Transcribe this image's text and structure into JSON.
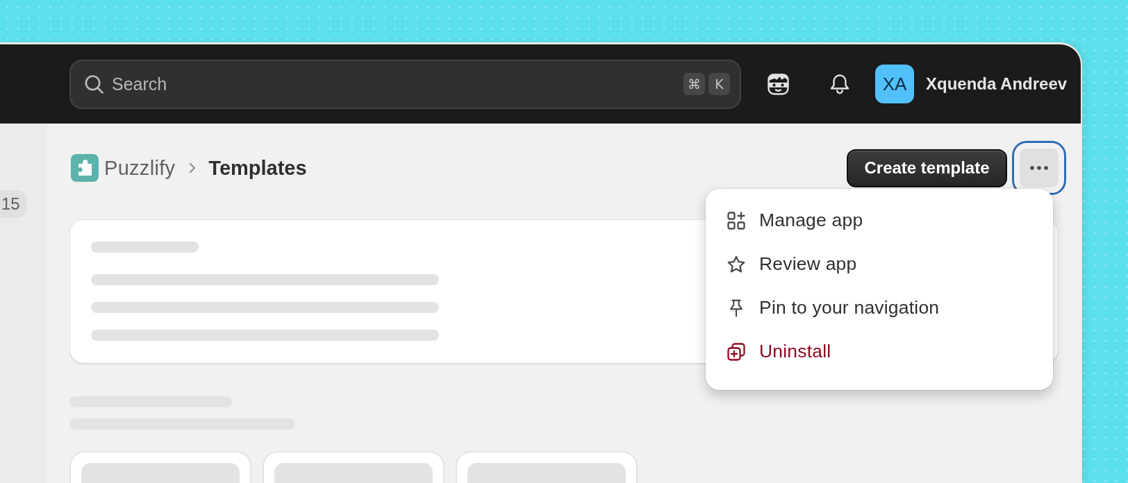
{
  "search": {
    "placeholder": "Search",
    "shortcut_keys": [
      "⌘",
      "K"
    ]
  },
  "user": {
    "initials": "XA",
    "name": "Xquenda Andreev"
  },
  "sidebar": {
    "badge": "15"
  },
  "breadcrumb": {
    "app": "Puzzlify",
    "page": "Templates"
  },
  "actions": {
    "primary_button": "Create template",
    "more_menu": {
      "expanded": true,
      "items": [
        {
          "label": "Manage app",
          "kind": "manage",
          "destructive": false
        },
        {
          "label": "Review app",
          "kind": "review",
          "destructive": false
        },
        {
          "label": "Pin to your navigation",
          "kind": "pin",
          "destructive": false
        },
        {
          "label": "Uninstall",
          "kind": "uninstall",
          "destructive": true
        }
      ]
    }
  },
  "content": {
    "loading": true
  }
}
